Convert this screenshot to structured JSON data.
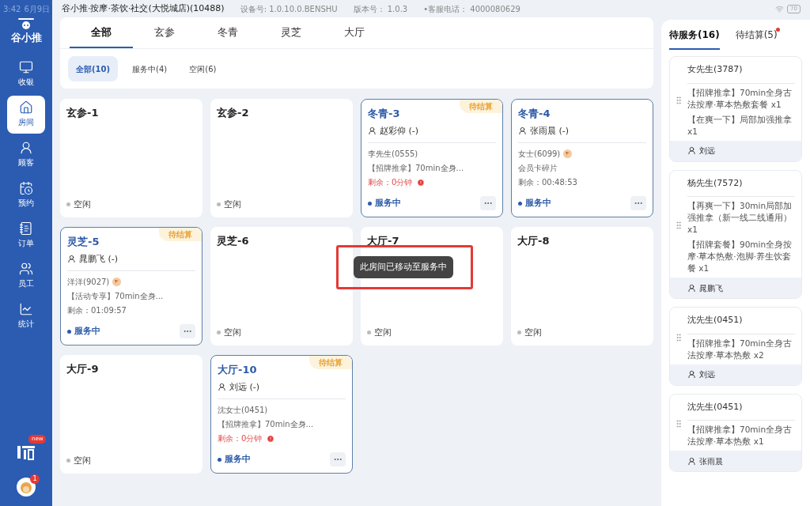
{
  "status_bar": {
    "time": "3:42",
    "date": "6月9日",
    "shop": "谷小推·按摩·茶饮·社交(大悦城店)(10488)",
    "device": "设备号: 1.0.10.0.BENSHU",
    "version": "版本号： 1.0.3",
    "phone": "•客服电话： 4000080629",
    "battery": "70"
  },
  "sidebar": {
    "logo": "谷小推",
    "items": [
      {
        "label": "收银",
        "selected": false
      },
      {
        "label": "房间",
        "selected": true
      },
      {
        "label": "顾客",
        "selected": false
      },
      {
        "label": "预约",
        "selected": false
      },
      {
        "label": "订单",
        "selected": false
      },
      {
        "label": "员工",
        "selected": false
      },
      {
        "label": "统计",
        "selected": false
      }
    ],
    "app_badge": "new",
    "avatar_badge": "1"
  },
  "area_tabs": [
    {
      "label": "全部",
      "selected": true
    },
    {
      "label": "玄参",
      "selected": false
    },
    {
      "label": "冬青",
      "selected": false
    },
    {
      "label": "灵芝",
      "selected": false
    },
    {
      "label": "大厅",
      "selected": false
    }
  ],
  "filters": [
    {
      "label": "全部(10)",
      "selected": true
    },
    {
      "label": "服务中(4)",
      "selected": false
    },
    {
      "label": "空闲(6)",
      "selected": false
    }
  ],
  "rooms": [
    {
      "name": "玄参-1",
      "kind": "idle",
      "status": "空闲"
    },
    {
      "name": "玄参-2",
      "kind": "idle",
      "status": "空闲"
    },
    {
      "name": "冬青-3",
      "kind": "serving",
      "status": "服务中",
      "badge": "待结算",
      "staff": "赵彩仰 (-)",
      "customer": "李先生(0555)",
      "vip": false,
      "detail": "【招牌推拿】70min全身...",
      "remaining": "剩余：0分钟",
      "overdue": true
    },
    {
      "name": "冬青-4",
      "kind": "serving",
      "status": "服务中",
      "staff": "张雨晨 (-)",
      "customer": "女士(6099)",
      "vip": true,
      "detail": "会员卡碎片",
      "remaining": "剩余：00:48:53",
      "overdue": false
    },
    {
      "name": "灵芝-5",
      "kind": "serving",
      "status": "服务中",
      "badge": "待结算",
      "staff": "晁鹏飞 (-)",
      "customer": "洋洋(9027)",
      "vip": true,
      "detail": "【活动专享】70min全身...",
      "remaining": "剩余：01:09:57",
      "overdue": false
    },
    {
      "name": "灵芝-6",
      "kind": "idle",
      "status": "空闲"
    },
    {
      "name": "大厅-7",
      "kind": "idle",
      "status": "空闲"
    },
    {
      "name": "大厅-8",
      "kind": "idle",
      "status": "空闲"
    },
    {
      "name": "大厅-9",
      "kind": "idle",
      "status": "空闲"
    },
    {
      "name": "大厅-10",
      "kind": "serving",
      "status": "服务中",
      "badge": "待结算",
      "staff": "刘远 (-)",
      "customer": "沈女士(0451)",
      "vip": false,
      "detail": "【招牌推拿】70min全身...",
      "remaining": "剩余：0分钟",
      "overdue": true
    }
  ],
  "toast": "此房间已移动至服务中",
  "queue_tabs": [
    {
      "label": "待服务(16)",
      "selected": true,
      "dot": false
    },
    {
      "label": "待结算(5)",
      "selected": false,
      "dot": true
    }
  ],
  "queue": [
    {
      "customer": "女先生(3787)",
      "items": [
        "【招牌推拿】70min全身古法按摩·草本热敷套餐 x1",
        "【在爽一下】局部加强推拿 x1"
      ],
      "staff": "刘远"
    },
    {
      "customer": "杨先生(7572)",
      "items": [
        "【再爽一下】30min局部加强推拿（新一线二线通用） x1",
        "【招牌套餐】90min全身按摩·草本热敷·泡脚·养生饮套餐 x1"
      ],
      "staff": "晁鹏飞"
    },
    {
      "customer": "沈先生(0451)",
      "items": [
        "【招牌推拿】70min全身古法按摩·草本热敷 x2"
      ],
      "staff": "刘远"
    },
    {
      "customer": "沈先生(0451)",
      "items": [
        "【招牌推拿】70min全身古法按摩·草本热敷 x1"
      ],
      "staff": "张雨晨"
    }
  ]
}
